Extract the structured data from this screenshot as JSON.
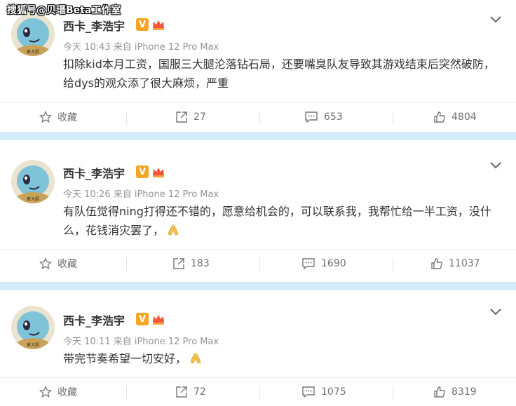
{
  "watermark": "搜狐号@贝瑨Beta工作室",
  "colors": {
    "accent_bg": "#d3ecf9",
    "verified_badge": "#f5a623",
    "text": "#333333",
    "muted": "#939393"
  },
  "avatar_caption": "章大厨",
  "posts": [
    {
      "author": "西卡_李浩宇",
      "meta": "今天 10:43 来自 iPhone 12 Pro Max",
      "text": "扣除kid本月工资，国服三大腿沦落钻石局，还要嘴臭队友导致其游戏结束后突然破防，给dys的观众添了很大麻烦，严重",
      "has_emoji": false,
      "actions": {
        "favorite": "收藏",
        "repost": "27",
        "comment": "653",
        "like": "4804"
      }
    },
    {
      "author": "西卡_李浩宇",
      "meta": "今天 10:26 来自 iPhone 12 Pro Max",
      "text": "有队伍觉得ning打得还不错的，愿意给机会的，可以联系我，我帮忙给一半工资，没什么，花钱消灾罢了，",
      "has_emoji": true,
      "actions": {
        "favorite": "收藏",
        "repost": "183",
        "comment": "1690",
        "like": "11037"
      }
    },
    {
      "author": "西卡_李浩宇",
      "meta": "今天 10:11 来自 iPhone 12 Pro Max",
      "text": "带完节奏希望一切安好，",
      "has_emoji": true,
      "actions": {
        "favorite": "收藏",
        "repost": "72",
        "comment": "1075",
        "like": "8319"
      }
    }
  ]
}
